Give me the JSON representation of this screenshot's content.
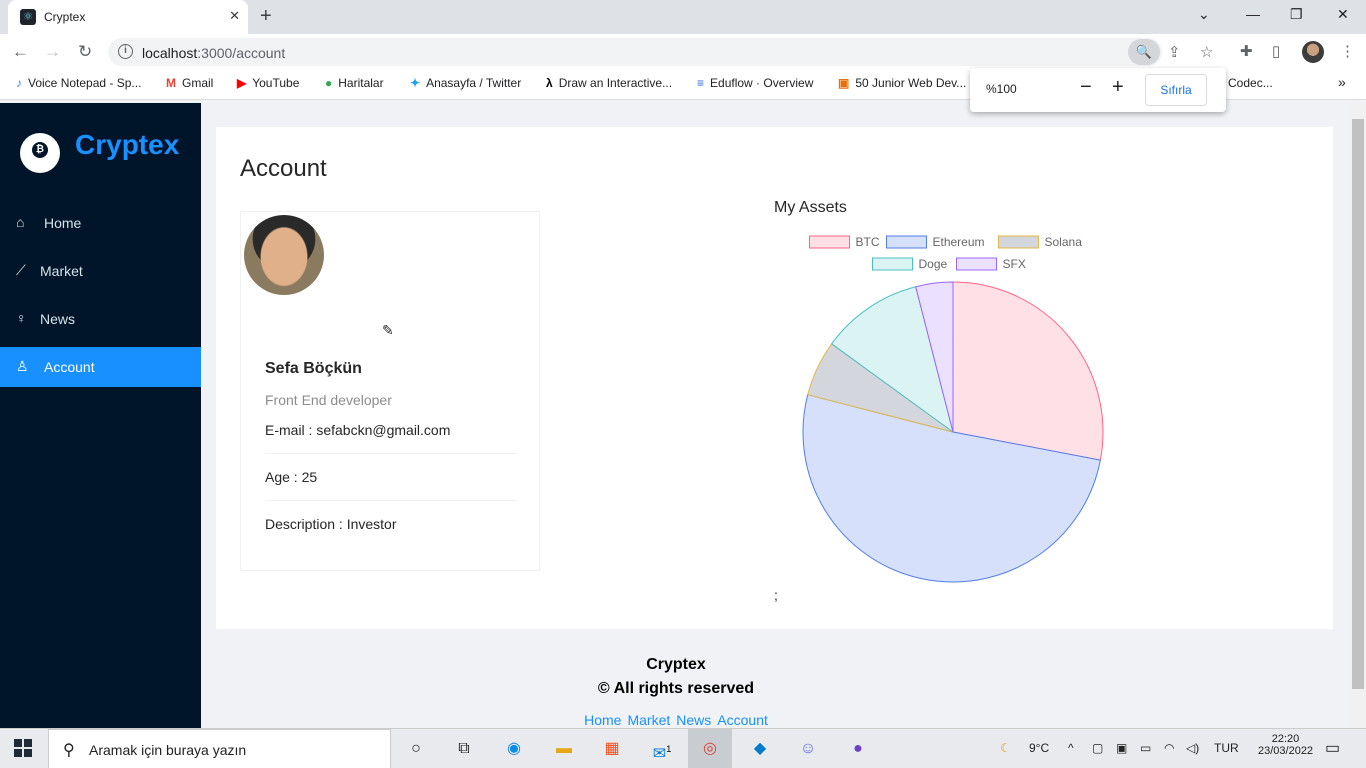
{
  "browser": {
    "tab_title": "Cryptex",
    "url_host": "localhost",
    "url_rest": ":3000/account",
    "zoom_value": "%100",
    "zoom_reset": "Sıfırla",
    "bookmarks": [
      {
        "icon": "voice-icon",
        "label": "Voice Notepad - Sp..."
      },
      {
        "icon": "gmail-icon",
        "label": "Gmail"
      },
      {
        "icon": "youtube-icon",
        "label": "YouTube"
      },
      {
        "icon": "maps-icon",
        "label": "Haritalar"
      },
      {
        "icon": "twitter-icon",
        "label": "Anasayfa / Twitter"
      },
      {
        "icon": "lambda-icon",
        "label": "Draw an Interactive..."
      },
      {
        "icon": "eduflow-icon",
        "label": "Eduflow · Overview"
      },
      {
        "icon": "star-icon",
        "label": "50 Junior Web Dev..."
      },
      {
        "icon": "codec-icon",
        "label": "Codec..."
      }
    ]
  },
  "sidebar": {
    "brand": "Cryptex",
    "items": [
      {
        "label": "Home",
        "icon": "home-icon",
        "active": false
      },
      {
        "label": "Market",
        "icon": "chart-line-icon",
        "active": false
      },
      {
        "label": "News",
        "icon": "bulb-icon",
        "active": false
      },
      {
        "label": "Account",
        "icon": "user-icon",
        "active": true
      }
    ]
  },
  "page": {
    "title": "Account",
    "profile": {
      "name": "Sefa Böçkün",
      "role": "Front End developer",
      "email": "E-mail : sefabckn@gmail.com",
      "age": "Age : 25",
      "description": "Description : Investor"
    },
    "assets_title": "My Assets",
    "stray_text": ";"
  },
  "chart_data": {
    "type": "pie",
    "title": "My Assets",
    "legend_position": "top",
    "categories": [
      "BTC",
      "Ethereum",
      "Solana",
      "Doge",
      "SFX"
    ],
    "values": [
      28,
      51,
      6,
      11,
      4
    ],
    "colors": [
      {
        "fill": "#ffe0e6",
        "stroke": "#ff6384"
      },
      {
        "fill": "#d7e0fa",
        "stroke": "#4f7ee8"
      },
      {
        "fill": "#d3d6dc",
        "stroke": "#e5b84a"
      },
      {
        "fill": "#dbf3f3",
        "stroke": "#4bc0c0"
      },
      {
        "fill": "#ebe0ff",
        "stroke": "#9966ff"
      }
    ]
  },
  "footer": {
    "title": "Cryptex",
    "rights": "© All rights reserved",
    "links": [
      "Home",
      "Market",
      "News",
      "Account"
    ]
  },
  "taskbar": {
    "search_placeholder": "Aramak için buraya yazın",
    "weather": "9°C",
    "lang": "TUR",
    "time": "22:20",
    "date": "23/03/2022",
    "mail_badge": "1"
  }
}
